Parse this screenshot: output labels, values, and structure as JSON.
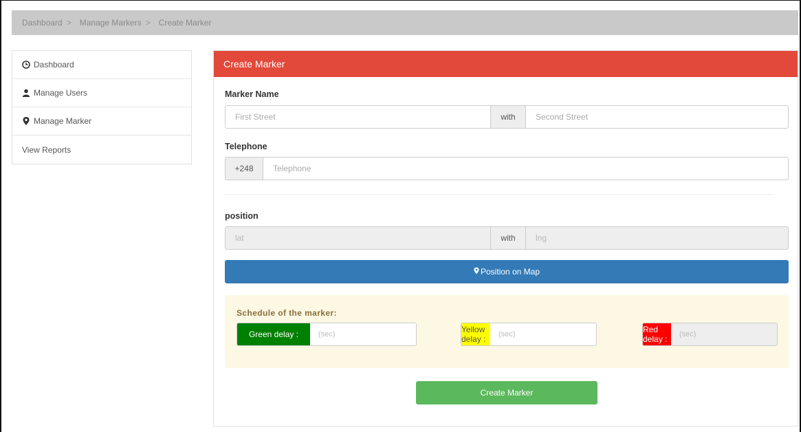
{
  "breadcrumb": {
    "items": [
      "Dashboard",
      "Manage Markers",
      "Create Marker"
    ],
    "separator": ">"
  },
  "sidebar": {
    "items": [
      {
        "label": "Dashboard",
        "icon": "clock-icon"
      },
      {
        "label": "Manage Users",
        "icon": "user-icon"
      },
      {
        "label": "Manage Marker",
        "icon": "map-marker-icon"
      },
      {
        "label": "View Reports",
        "icon": ""
      }
    ]
  },
  "panel": {
    "title": "Create Marker",
    "marker_name": {
      "label": "Marker Name",
      "first_placeholder": "First Street",
      "with_label": "with",
      "second_placeholder": "Second Street"
    },
    "telephone": {
      "label": "Telephone",
      "prefix": "+248",
      "placeholder": "Telephone"
    },
    "position": {
      "label": "position",
      "lat_placeholder": "lat",
      "with_label": "with",
      "lng_placeholder": "lng"
    },
    "map_button": "Position on Map",
    "schedule": {
      "title": "Schedule of the marker:",
      "green": {
        "label": "Green delay :",
        "placeholder": "(sec)",
        "color": "#008000"
      },
      "yellow": {
        "label": "Yellow delay :",
        "placeholder": "(sec)",
        "color": "#ffff00"
      },
      "red": {
        "label": "Red delay :",
        "placeholder": "(sec)",
        "color": "#ff0000"
      }
    },
    "submit_button": "Create Marker"
  },
  "colors": {
    "panel_header": "#e2493a",
    "map_button": "#337ab7",
    "submit_button": "#5cb85c",
    "schedule_bg": "#fcf8e3"
  }
}
